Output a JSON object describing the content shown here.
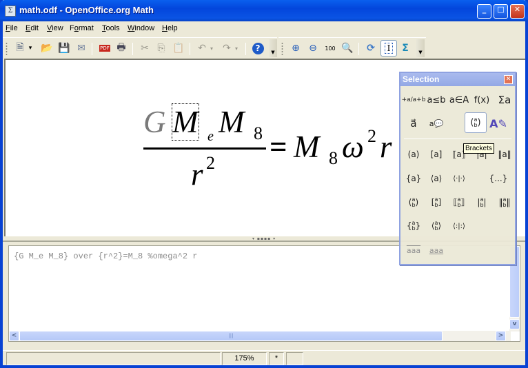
{
  "window": {
    "title": "math.odf - OpenOffice.org Math",
    "controls": {
      "minimize": "_",
      "maximize": "□",
      "close": "✕"
    }
  },
  "menu": {
    "items": [
      {
        "label": "File",
        "accel": "F",
        "rest": "ile"
      },
      {
        "label": "Edit",
        "accel": "E",
        "rest": "dit"
      },
      {
        "label": "View",
        "accel": "V",
        "rest": "iew"
      },
      {
        "label": "Format",
        "accel": "o",
        "pre": "F",
        "rest": "rmat"
      },
      {
        "label": "Tools",
        "accel": "T",
        "rest": "ools"
      },
      {
        "label": "Window",
        "accel": "W",
        "rest": "indow"
      },
      {
        "label": "Help",
        "accel": "H",
        "rest": "elp"
      }
    ]
  },
  "toolbar": {
    "standard": [
      {
        "name": "new-document-icon",
        "glyph": "🗎"
      },
      {
        "name": "new-dropdown-icon",
        "glyph": "▾"
      },
      {
        "name": "open-icon",
        "glyph": "📂"
      },
      {
        "name": "save-icon",
        "glyph": "💾"
      },
      {
        "name": "email-icon",
        "glyph": "✉"
      },
      {
        "name": "export-pdf-icon",
        "glyph": "PDF"
      },
      {
        "name": "print-icon",
        "glyph": "🖶"
      },
      {
        "name": "cut-icon",
        "glyph": "✂"
      },
      {
        "name": "copy-icon",
        "glyph": "⎘"
      },
      {
        "name": "paste-icon",
        "glyph": "📋"
      },
      {
        "name": "undo-icon",
        "glyph": "↶"
      },
      {
        "name": "redo-icon",
        "glyph": "↷"
      },
      {
        "name": "help-icon",
        "glyph": "?"
      }
    ],
    "math": [
      {
        "name": "zoom-in-icon",
        "glyph": "⊕"
      },
      {
        "name": "zoom-out-icon",
        "glyph": "⊖"
      },
      {
        "name": "zoom-100-icon",
        "glyph": "100"
      },
      {
        "name": "show-all-icon",
        "glyph": "🔍"
      },
      {
        "name": "update-icon",
        "glyph": "⟳"
      },
      {
        "name": "formula-cursor-icon",
        "glyph": "I"
      },
      {
        "name": "symbols-icon",
        "glyph": "Σ"
      }
    ]
  },
  "formula": {
    "numerator": {
      "G": "G",
      "M1": "M",
      "sub1": "e",
      "M2": "M",
      "sub2": "8"
    },
    "denominator": {
      "base": "r",
      "exp": "2"
    },
    "equals": "=",
    "rhs": {
      "M": "M",
      "sub": "8",
      "omega": "ω",
      "exp": "2",
      "r": "r"
    }
  },
  "command": {
    "text": "{G M_e M_8} over {r^2}=M_8 %omega^2 r"
  },
  "statusbar": {
    "message": "",
    "zoom": "175%",
    "modified": "*",
    "extra": ""
  },
  "selection": {
    "title": "Selection",
    "tooltip": "Brackets",
    "categories": [
      {
        "name": "unary-binary-operators",
        "label": "+a/a+b"
      },
      {
        "name": "relations",
        "label": "a≤b"
      },
      {
        "name": "set-operations",
        "label": "a∈A"
      },
      {
        "name": "functions",
        "label": "f(x)"
      },
      {
        "name": "operators",
        "label": "Σa"
      },
      {
        "name": "attributes",
        "label": "a⃗"
      },
      {
        "name": "others",
        "label": "a💬"
      },
      {
        "name": "brackets",
        "label": "(a b)"
      },
      {
        "name": "formats",
        "label": "A✎"
      }
    ],
    "bracket_items": [
      "(a)",
      "[a]",
      "⟦a⟧",
      "|a|",
      "‖a‖",
      "{a}",
      "⟨a⟩",
      "⟨·|·⟩",
      "{...}",
      "(a/b)",
      "[a/b]",
      "⟦a/b⟧",
      "|a/b|",
      "‖a/b‖",
      "{a/b}",
      "⟨a/b⟩",
      "⟨:|:⟩",
      "a͡aa",
      "a͜aa"
    ]
  }
}
